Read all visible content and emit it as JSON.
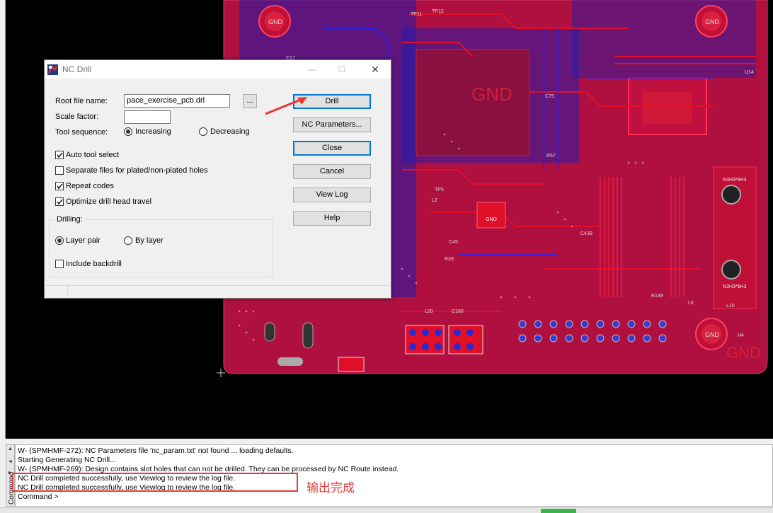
{
  "dialog": {
    "title": "NC Drill",
    "root_file_label": "Root file name:",
    "root_file_value": "pace_exercise_pcb.drl",
    "browse_label": "...",
    "scale_factor_label": "Scale factor:",
    "scale_factor_value": "",
    "tool_sequence_label": "Tool sequence:",
    "increasing_label": "Increasing",
    "decreasing_label": "Decreasing",
    "tool_sequence_selected": "Increasing",
    "checkboxes": [
      {
        "label": "Auto tool select",
        "checked": true
      },
      {
        "label": "Separate files for plated/non-plated holes",
        "checked": false
      },
      {
        "label": "Repeat codes",
        "checked": true
      },
      {
        "label": "Optimize drill head travel",
        "checked": true
      }
    ],
    "drilling_group_label": "Drilling:",
    "layer_pair_label": "Layer pair",
    "by_layer_label": "By layer",
    "drilling_selected": "Layer pair",
    "include_backdrill_label": "Include backdrill",
    "include_backdrill_checked": false,
    "buttons": {
      "drill": "Drill",
      "nc_parameters": "NC Parameters...",
      "close": "Close",
      "cancel": "Cancel",
      "view_log": "View Log",
      "help": "Help"
    },
    "window_controls": {
      "minimize": "—",
      "maximize": "☐",
      "close": "✕"
    }
  },
  "pcb": {
    "gnd_labels": [
      "GND",
      "GND",
      "GND",
      "GND",
      "GND",
      "GND"
    ],
    "component_labels": [
      "TP11",
      "TP12",
      "C75",
      "TP5",
      "L2",
      "R39",
      "C45",
      "C439",
      "L10",
      "H4",
      "U14",
      "L6",
      "R57",
      "L20",
      "C180",
      "R148",
      "C17"
    ],
    "connector_label": "N3H3*6H3"
  },
  "command": {
    "side_label": "Command",
    "lines": [
      "W- (SPMHMF-272): NC Parameters file 'nc_param.txt' not found ... loading defaults.",
      "Starting Generating NC Drill...",
      "W- (SPMHMF-269): Design contains slot holes that can not be drilled. They can be processed by NC Route instead.",
      "NC Drill completed successfully, use Viewlog to review the log file.",
      "NC Drill completed successfully, use Viewlog to review the log file.",
      "Command >"
    ]
  },
  "annotation": {
    "note": "输出完成",
    "color": "#e53935"
  },
  "colors": {
    "board": "#b01040",
    "board_dark": "#7a1030",
    "trace_blue": "#1c1cb0",
    "trace_red": "#e0102a",
    "pad_gray": "#9a9a9a"
  }
}
